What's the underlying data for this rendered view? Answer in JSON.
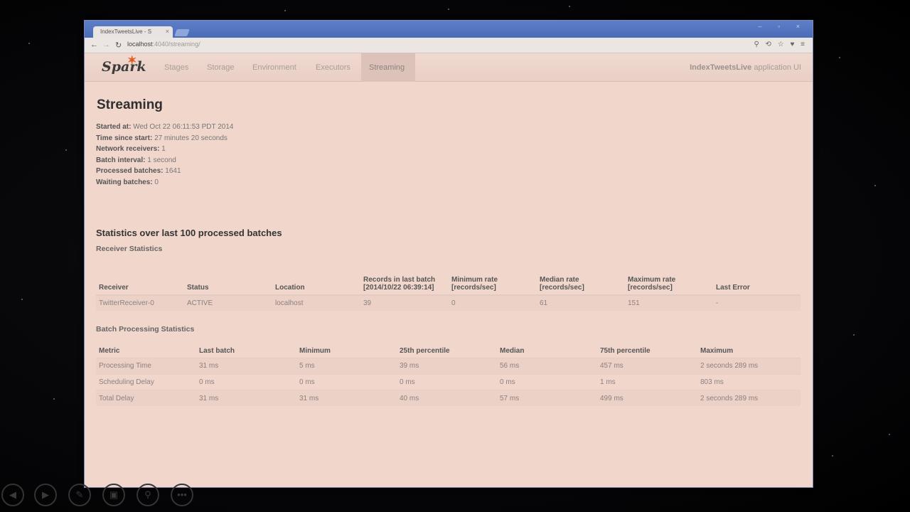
{
  "browser": {
    "tab_title": "IndexTweetsLive - S",
    "tab_close": "×",
    "url_host": "localhost",
    "url_path": ":4040/streaming/",
    "nav_back": "←",
    "nav_forward": "→",
    "nav_reload": "↻",
    "window_controls": "– ▫ ×",
    "addr_right_icons": "⚲ ⟲ ☆ ♥ ≡"
  },
  "spark_nav": {
    "logo": "Spark",
    "logo_star": "✶",
    "links": [
      "Stages",
      "Storage",
      "Environment",
      "Executors",
      "Streaming"
    ],
    "active_link": "Streaming",
    "app_name": "IndexTweetsLive",
    "app_suffix": " application UI"
  },
  "page": {
    "title": "Streaming",
    "summary": [
      {
        "label": "Started at:",
        "value": "Wed Oct 22 06:11:53 PDT 2014"
      },
      {
        "label": "Time since start:",
        "value": "27 minutes 20 seconds"
      },
      {
        "label": "Network receivers:",
        "value": "1"
      },
      {
        "label": "Batch interval:",
        "value": "1 second"
      },
      {
        "label": "Processed batches:",
        "value": "1641"
      },
      {
        "label": "Waiting batches:",
        "value": "0"
      }
    ],
    "stats_title": "Statistics over last 100 processed batches",
    "receiver_stats_title": "Receiver Statistics",
    "batch_stats_title": "Batch Processing Statistics"
  },
  "receiver_table": {
    "headers": [
      "Receiver",
      "Status",
      "Location",
      "Records in last batch\n[2014/10/22 06:39:14]",
      "Minimum rate\n[records/sec]",
      "Median rate\n[records/sec]",
      "Maximum rate\n[records/sec]",
      "Last Error"
    ],
    "rows": [
      [
        "TwitterReceiver-0",
        "ACTIVE",
        "localhost",
        "39",
        "0",
        "61",
        "151",
        "-"
      ]
    ]
  },
  "batch_table": {
    "headers": [
      "Metric",
      "Last batch",
      "Minimum",
      "25th percentile",
      "Median",
      "75th percentile",
      "Maximum"
    ],
    "rows": [
      [
        "Processing Time",
        "31 ms",
        "5 ms",
        "39 ms",
        "56 ms",
        "457 ms",
        "2 seconds 289 ms"
      ],
      [
        "Scheduling Delay",
        "0 ms",
        "0 ms",
        "0 ms",
        "0 ms",
        "1 ms",
        "803 ms"
      ],
      [
        "Total Delay",
        "31 ms",
        "31 ms",
        "40 ms",
        "57 ms",
        "499 ms",
        "2 seconds 289 ms"
      ]
    ]
  },
  "presentation_bar": {
    "buttons": [
      {
        "icon": "previous-icon",
        "glyph": "◀"
      },
      {
        "icon": "next-icon",
        "glyph": "▶"
      },
      {
        "icon": "pen-icon",
        "glyph": "✎"
      },
      {
        "icon": "slides-icon",
        "glyph": "▣"
      },
      {
        "icon": "zoom-icon",
        "glyph": "⚲"
      },
      {
        "icon": "more-icon",
        "glyph": "•••"
      }
    ]
  }
}
